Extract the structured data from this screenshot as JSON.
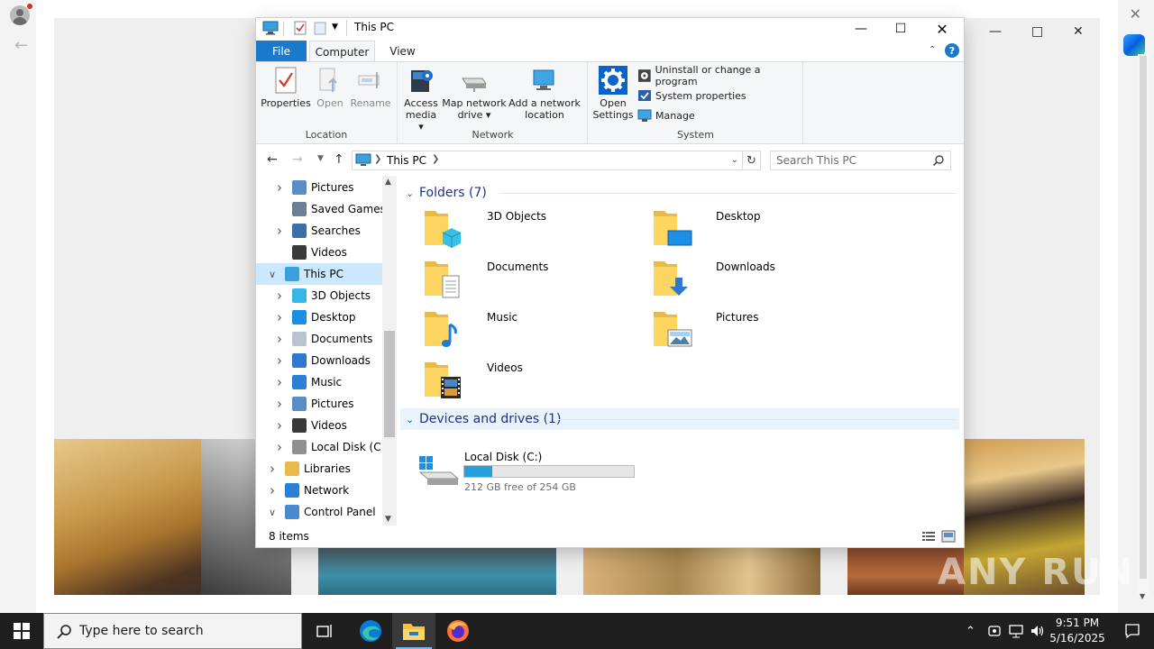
{
  "explorer": {
    "title": "This PC",
    "tabs": {
      "file": "File",
      "computer": "Computer",
      "view": "View"
    },
    "ribbon": {
      "location": {
        "label": "Location",
        "properties": "Properties",
        "open": "Open",
        "rename": "Rename"
      },
      "network": {
        "label": "Network",
        "access_media_1": "Access",
        "access_media_2": "media",
        "map_drive_1": "Map network",
        "map_drive_2": "drive",
        "add_location_1": "Add a network",
        "add_location_2": "location"
      },
      "system": {
        "label": "System",
        "open_settings_1": "Open",
        "open_settings_2": "Settings",
        "uninstall": "Uninstall or change a program",
        "system_properties": "System properties",
        "manage": "Manage"
      }
    },
    "address": {
      "crumb": "This PC"
    },
    "search": {
      "placeholder": "Search This PC"
    },
    "nav_tree": [
      {
        "label": "Pictures",
        "icon": "pictures-icon"
      },
      {
        "label": "Saved Games",
        "icon": "saved-games-icon"
      },
      {
        "label": "Searches",
        "icon": "searches-icon"
      },
      {
        "label": "Videos",
        "icon": "videos-icon"
      },
      {
        "label": "This PC",
        "icon": "this-pc-icon"
      },
      {
        "label": "3D Objects",
        "icon": "3d-objects-icon"
      },
      {
        "label": "Desktop",
        "icon": "desktop-icon"
      },
      {
        "label": "Documents",
        "icon": "documents-icon"
      },
      {
        "label": "Downloads",
        "icon": "downloads-icon"
      },
      {
        "label": "Music",
        "icon": "music-icon"
      },
      {
        "label": "Pictures",
        "icon": "pictures-icon"
      },
      {
        "label": "Videos",
        "icon": "videos-icon"
      },
      {
        "label": "Local Disk (C:)",
        "icon": "drive-icon"
      },
      {
        "label": "Libraries",
        "icon": "libraries-icon"
      },
      {
        "label": "Network",
        "icon": "network-icon"
      },
      {
        "label": "Control Panel",
        "icon": "control-panel-icon"
      }
    ],
    "groups": {
      "folders": "Folders (7)",
      "devices": "Devices and drives (1)"
    },
    "folders": [
      {
        "name": "3D Objects",
        "icon": "3d-objects-folder-icon"
      },
      {
        "name": "Desktop",
        "icon": "desktop-folder-icon"
      },
      {
        "name": "Documents",
        "icon": "documents-folder-icon"
      },
      {
        "name": "Downloads",
        "icon": "downloads-folder-icon"
      },
      {
        "name": "Music",
        "icon": "music-folder-icon"
      },
      {
        "name": "Pictures",
        "icon": "pictures-folder-icon"
      },
      {
        "name": "Videos",
        "icon": "videos-folder-icon"
      }
    ],
    "drive": {
      "name": "Local Disk (C:)",
      "free_text": "212 GB free of 254 GB",
      "used_fraction": 0.165
    },
    "status": {
      "items": "8 items"
    }
  },
  "taskbar": {
    "search_text": "Type here to search",
    "time": "9:51 PM",
    "date": "5/16/2025"
  },
  "watermark": "ANY RUN",
  "colors": {
    "accent": "#1979ca",
    "selection": "#cce8ff",
    "drive_bar": "#26a0da",
    "taskbar": "#1f1f1f"
  }
}
